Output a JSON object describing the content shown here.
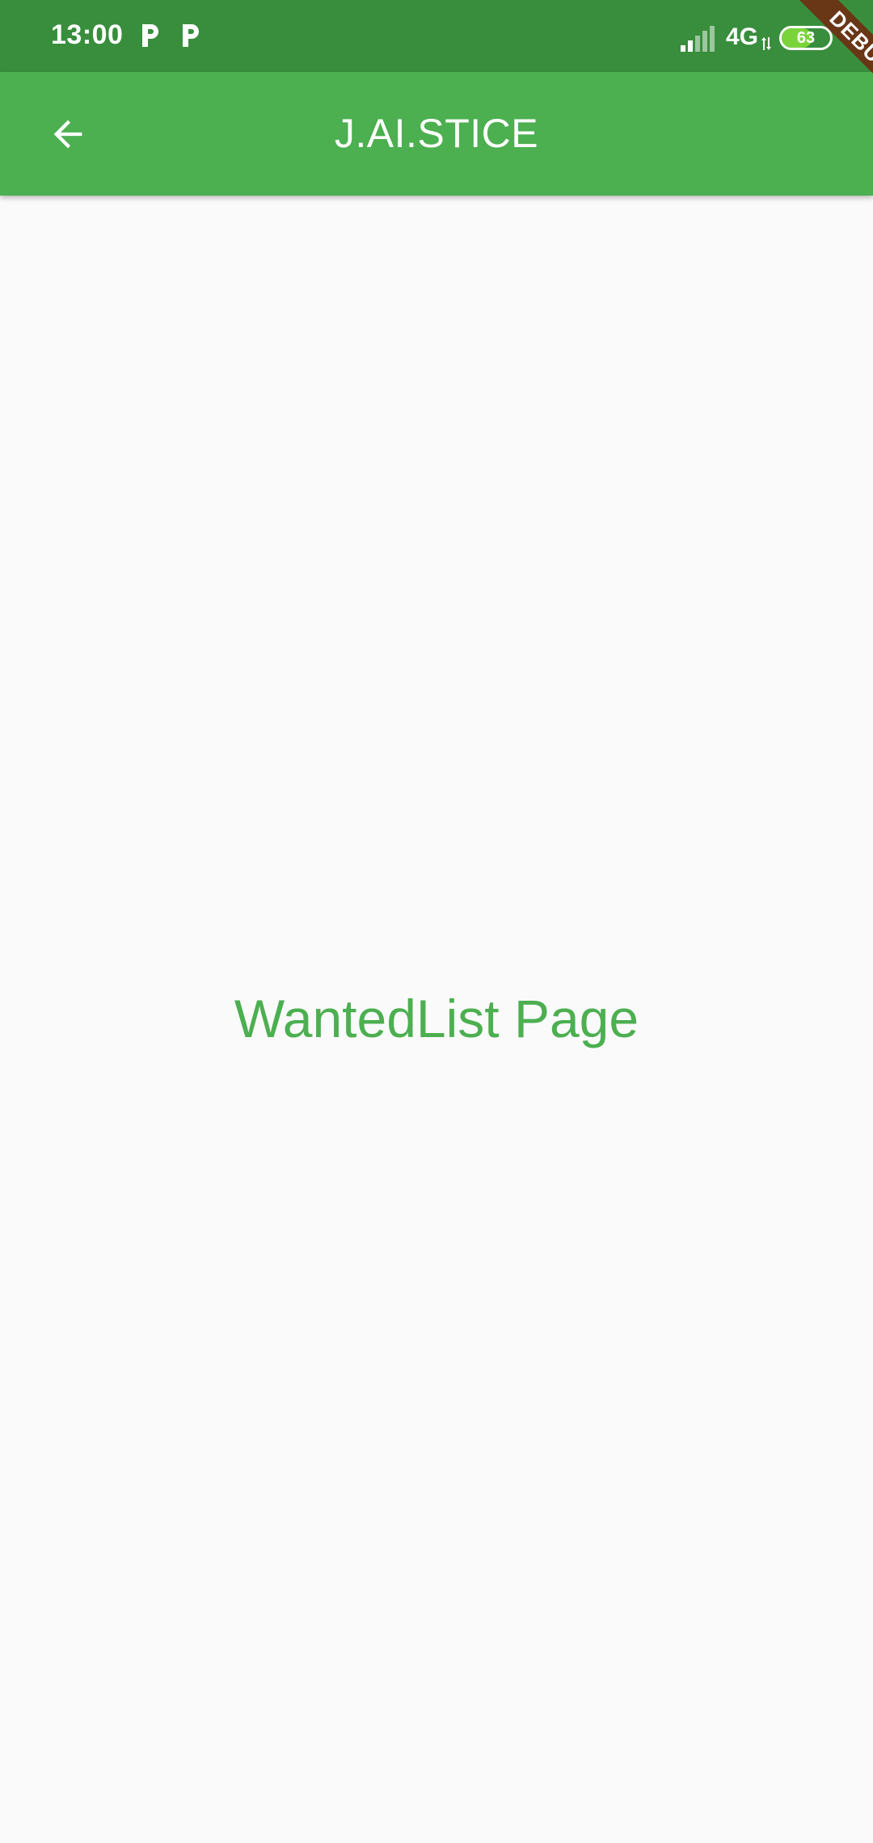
{
  "status_bar": {
    "time": "13:00",
    "notification_icons": [
      "parking-icon",
      "parking-icon"
    ],
    "network": "4G",
    "battery_level": "63",
    "background_color": "#388e3c"
  },
  "app_bar": {
    "title": "J.AI.STICE",
    "back_icon": "arrow-back-icon",
    "background_color": "#4caf50"
  },
  "main": {
    "text": "WantedList Page",
    "text_color": "#4caf50"
  },
  "debug_banner": {
    "label": "DEBUG"
  }
}
